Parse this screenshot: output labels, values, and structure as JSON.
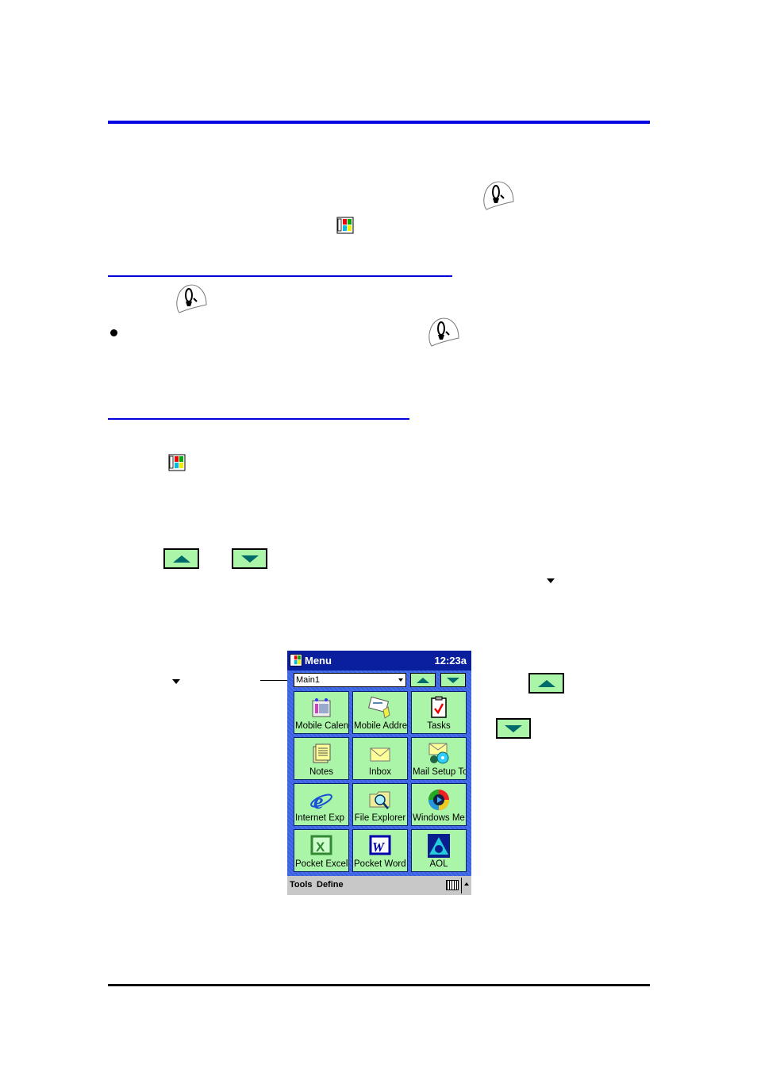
{
  "page": {
    "bullet_count": 1
  },
  "pda": {
    "title": "Menu",
    "clock": "12:23a",
    "combo_value": "Main1",
    "apps": [
      {
        "label": "Mobile Calendar",
        "display": "Mobile Calend",
        "icon": "calendar-icon"
      },
      {
        "label": "Mobile Address",
        "display": "Mobile Addre",
        "icon": "address-card-icon"
      },
      {
        "label": "Tasks",
        "display": "Tasks",
        "icon": "tasks-clipboard-icon"
      },
      {
        "label": "Notes",
        "display": "Notes",
        "icon": "notes-icon"
      },
      {
        "label": "Inbox",
        "display": "Inbox",
        "icon": "envelope-icon"
      },
      {
        "label": "Mail Setup Tool",
        "display": "Mail Setup To",
        "icon": "mail-setup-icon"
      },
      {
        "label": "Internet Explorer",
        "display": "Internet Exp",
        "icon": "internet-explorer-icon"
      },
      {
        "label": "File Explorer",
        "display": "File Explorer",
        "icon": "file-explorer-icon"
      },
      {
        "label": "Windows Media",
        "display": "Windows Me",
        "icon": "windows-media-icon"
      },
      {
        "label": "Pocket Excel",
        "display": "Pocket Excel",
        "icon": "excel-icon"
      },
      {
        "label": "Pocket Word",
        "display": "Pocket Word",
        "icon": "word-icon"
      },
      {
        "label": "AOL",
        "display": "AOL",
        "icon": "aol-icon"
      }
    ],
    "menubar": {
      "tools": "Tools",
      "define": "Define"
    }
  },
  "colors": {
    "rule_blue": "#0000e0",
    "tile_green": "#aaf5a8",
    "arrow_teal": "#006b6b",
    "pda_title_bar": "#0a1f9e",
    "pda_background": "#3b66e8"
  }
}
